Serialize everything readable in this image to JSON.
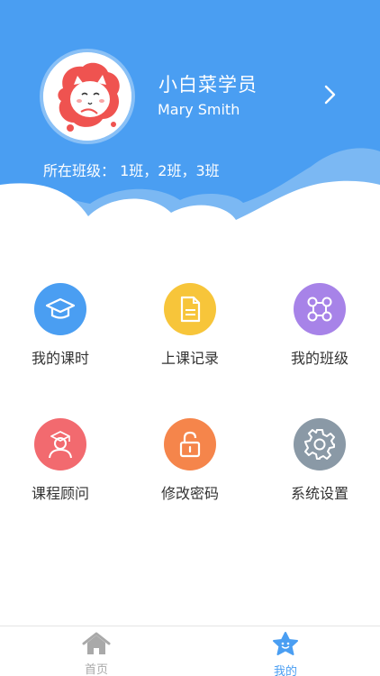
{
  "colors": {
    "header_blue": "#4a9ef2",
    "cloud_light": "#7bb8f3",
    "tab_active": "#4a9ef2",
    "tab_inactive": "#a9a9a9"
  },
  "profile": {
    "name": "小白菜学员",
    "subtitle": "Mary Smith",
    "class_label": "所在班级：",
    "class_value": "1班，2班，3班"
  },
  "features": [
    {
      "label": "我的课时",
      "icon": "graduation-cap-icon",
      "color": "#4a9ef2"
    },
    {
      "label": "上课记录",
      "icon": "document-icon",
      "color": "#f7c53a"
    },
    {
      "label": "我的班级",
      "icon": "network-nodes-icon",
      "color": "#a783e8"
    },
    {
      "label": "课程顾问",
      "icon": "advisor-icon",
      "color": "#f26a6f"
    },
    {
      "label": "修改密码",
      "icon": "lock-icon",
      "color": "#f5854b"
    },
    {
      "label": "系统设置",
      "icon": "gear-icon",
      "color": "#8a99a6"
    }
  ],
  "tabs": [
    {
      "label": "首页",
      "icon": "home-icon",
      "active": false
    },
    {
      "label": "我的",
      "icon": "star-smile-icon",
      "active": true
    }
  ]
}
